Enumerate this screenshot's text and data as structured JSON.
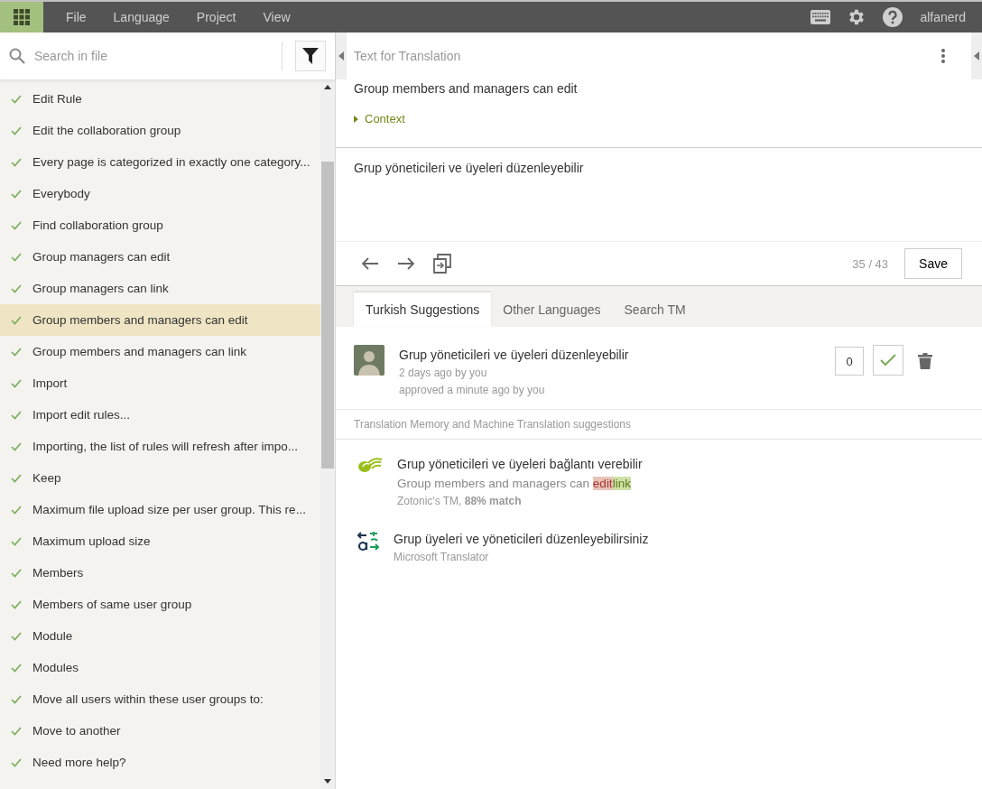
{
  "menu_bar": {
    "items": [
      "File",
      "Language",
      "Project",
      "View"
    ],
    "user": "alfanerd"
  },
  "sidebar": {
    "search": {
      "placeholder": "Search in file"
    },
    "items": [
      {
        "label": "Edit Rule",
        "translated": true,
        "selected": false
      },
      {
        "label": "Edit the collaboration group",
        "translated": true,
        "selected": false
      },
      {
        "label": "Every page is categorized in exactly one category...",
        "translated": true,
        "selected": false
      },
      {
        "label": "Everybody",
        "translated": true,
        "selected": false
      },
      {
        "label": "Find collaboration group",
        "translated": true,
        "selected": false
      },
      {
        "label": "Group managers can edit",
        "translated": true,
        "selected": false
      },
      {
        "label": "Group managers can link",
        "translated": true,
        "selected": false
      },
      {
        "label": "Group members and managers can edit",
        "translated": true,
        "selected": true
      },
      {
        "label": "Group members and managers can link",
        "translated": true,
        "selected": false
      },
      {
        "label": "Import",
        "translated": true,
        "selected": false
      },
      {
        "label": "Import edit rules...",
        "translated": true,
        "selected": false
      },
      {
        "label": "Importing, the list of rules will refresh after impo...",
        "translated": true,
        "selected": false
      },
      {
        "label": "Keep",
        "translated": true,
        "selected": false
      },
      {
        "label": "Maximum file upload size per user group. This re...",
        "translated": true,
        "selected": false
      },
      {
        "label": "Maximum upload size",
        "translated": true,
        "selected": false
      },
      {
        "label": "Members",
        "translated": true,
        "selected": false
      },
      {
        "label": "Members of same user group",
        "translated": true,
        "selected": false
      },
      {
        "label": "Module",
        "translated": true,
        "selected": false
      },
      {
        "label": "Modules",
        "translated": true,
        "selected": false
      },
      {
        "label": "Move all users within these user groups to:",
        "translated": true,
        "selected": false
      },
      {
        "label": "Move to another",
        "translated": true,
        "selected": false
      },
      {
        "label": "Need more help?",
        "translated": true,
        "selected": false
      }
    ]
  },
  "editor": {
    "title": "Text for Translation",
    "source": "Group members and managers can edit",
    "context_label": "Context",
    "context_expanded": false,
    "translation": "Grup yöneticileri ve üyeleri düzenleyebilir",
    "progress": "35 / 43",
    "save": "Save"
  },
  "suggestion_tabs": [
    {
      "label": "Turkish Suggestions",
      "selected": true
    },
    {
      "label": "Other Languages",
      "selected": false
    },
    {
      "label": "Search TM",
      "selected": false
    }
  ],
  "suggestions": [
    {
      "text": "Grup yöneticileri ve üyeleri düzenleyebilir",
      "meta": [
        "2 days ago by you",
        "approved a minute ago by you"
      ],
      "votes": "0",
      "approved": true
    }
  ],
  "tm_heading": "Translation Memory and Machine Translation suggestions",
  "tm_suggestions": [
    {
      "kind": "tm",
      "text": "Grup yöneticileri ve üyeleri bağlantı verebilir",
      "source_diff": [
        {
          "kind": "same",
          "text": "Group members and managers can "
        },
        {
          "kind": "deleted",
          "text": "edit"
        },
        {
          "kind": "inserted",
          "text": "link"
        }
      ],
      "origin": "Zotonic's TM, **88% match**"
    },
    {
      "kind": "mt",
      "text": "Grup üyeleri ve yöneticileri düzenleyebilirsiniz",
      "origin": "Microsoft Translator"
    }
  ]
}
